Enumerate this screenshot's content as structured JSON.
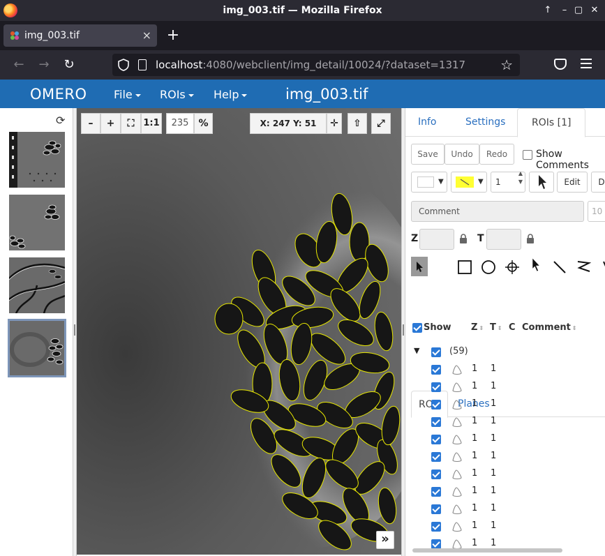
{
  "window": {
    "title": "img_003.tif — Mozilla Firefox",
    "controls": [
      "↑",
      "–",
      "▢",
      "✕"
    ]
  },
  "tab": {
    "title": "img_003.tif",
    "close": "×",
    "new_tab": "+"
  },
  "address_bar": {
    "host": "localhost",
    "rest": ":4080/webclient/img_detail/10024/?dataset=1317"
  },
  "omero": {
    "brand": "OMERO",
    "menus": [
      "File",
      "ROIs",
      "Help"
    ],
    "image_title": "img_003.tif"
  },
  "viewer": {
    "zoom_out": "–",
    "zoom_in": "+",
    "fit": "⛶",
    "one_to_one": "1:1",
    "zoom_value": "235",
    "zoom_unit": "%",
    "coords": "X: 247 Y: 51",
    "expand": "»"
  },
  "right_panel": {
    "tabs": [
      "Info",
      "Settings",
      "ROIs [1]"
    ],
    "save": "Save",
    "undo": "Undo",
    "redo": "Redo",
    "show_comments": "Show Comments",
    "stroke_width": "1",
    "edit": "Edit",
    "delete_partial": "D",
    "comment_placeholder": "Comment",
    "font_size_partial": "10",
    "z_label": "Z",
    "t_label": "T",
    "subtabs": [
      "ROIs",
      "Planes"
    ],
    "columns": {
      "show": "Show",
      "z": "Z",
      "t": "T",
      "c": "C",
      "comment": "Comment"
    },
    "group_count": "(59)",
    "rows": [
      {
        "z": "1",
        "t": "1"
      },
      {
        "z": "1",
        "t": "1"
      },
      {
        "z": "1",
        "t": "1"
      },
      {
        "z": "1",
        "t": "1"
      },
      {
        "z": "1",
        "t": "1"
      },
      {
        "z": "1",
        "t": "1"
      },
      {
        "z": "1",
        "t": "1"
      },
      {
        "z": "1",
        "t": "1"
      },
      {
        "z": "1",
        "t": "1"
      },
      {
        "z": "1",
        "t": "1"
      },
      {
        "z": "1",
        "t": "1"
      }
    ]
  },
  "colors": {
    "omero_blue": "#1f6cb3",
    "roi_outline": "#e6e600",
    "link_blue": "#2a6fbf",
    "check_blue": "#2a78d6"
  }
}
